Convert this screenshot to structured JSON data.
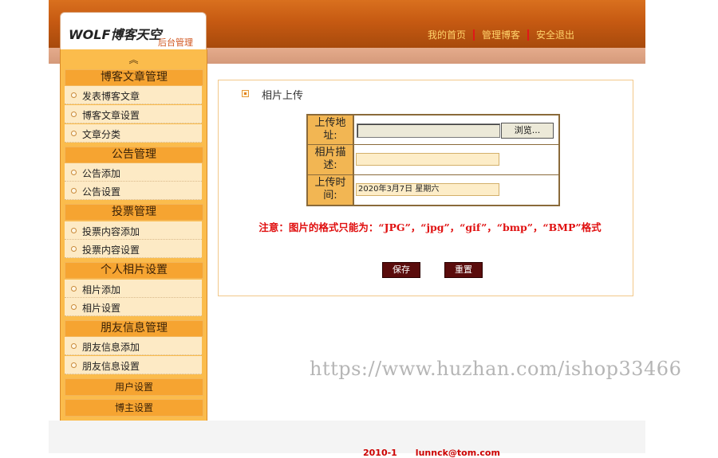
{
  "header": {
    "logo_title": "WOLF博客天空",
    "logo_sub": "后台管理",
    "nav": [
      "我的首页",
      "管理博客",
      "安全退出"
    ]
  },
  "sidebar": {
    "collapse_glyph": "︽",
    "sections": [
      {
        "title": "博客文章管理",
        "items": [
          "发表博客文章",
          "博客文章设置",
          "文章分类"
        ]
      },
      {
        "title": "公告管理",
        "items": [
          "公告添加",
          "公告设置"
        ]
      },
      {
        "title": "投票管理",
        "items": [
          "投票内容添加",
          "投票内容设置"
        ]
      },
      {
        "title": "个人相片设置",
        "items": [
          "相片添加",
          "相片设置"
        ]
      },
      {
        "title": "朋友信息管理",
        "items": [
          "朋友信息添加",
          "朋友信息设置"
        ]
      }
    ],
    "bottom_links": [
      "用户设置",
      "博主设置"
    ]
  },
  "main": {
    "title": "相片上传",
    "form": {
      "upload_label": "上传地址:",
      "browse_label": "浏览...",
      "desc_label": "相片描述:",
      "time_label": "上传时间:",
      "time_value": "2020年3月7日 星期六"
    },
    "note": "注意：图片的格式只能为：“JPG”，“jpg”，“gif”，“bmp”，“BMP”格式",
    "save_label": "保存",
    "reset_label": "重置"
  },
  "watermark": "https://www.huzhan.com/ishop33466",
  "footer": "2010-1      lunnck@tom.com"
}
